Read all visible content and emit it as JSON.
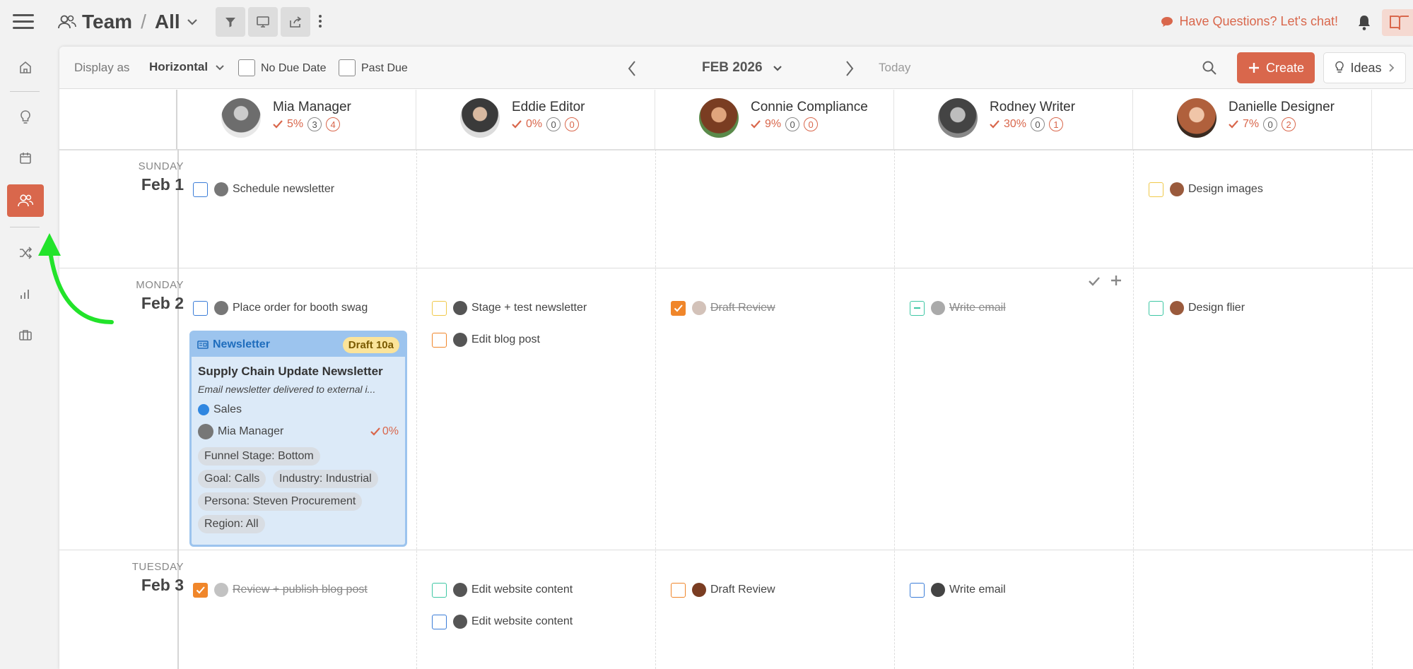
{
  "header": {
    "crumb_section": "Team",
    "crumb_sep": "/",
    "crumb_view": "All",
    "chat": "Have Questions? Let's chat!"
  },
  "toolbar": {
    "display_as_label": "Display as",
    "display_mode": "Horizontal",
    "no_due_date": "No Due Date",
    "past_due": "Past Due",
    "month": "FEB 2026",
    "today": "Today",
    "create": "Create",
    "ideas": "Ideas"
  },
  "people": [
    {
      "name": "Mia Manager",
      "pct": "5%",
      "a": "3",
      "b": "4",
      "avatar_color": "#6d6d6d"
    },
    {
      "name": "Eddie Editor",
      "pct": "0%",
      "a": "0",
      "b": "0",
      "avatar_color": "#7a7a7a"
    },
    {
      "name": "Connie Compliance",
      "pct": "9%",
      "a": "0",
      "b": "0",
      "avatar_color": "#9b5c3c"
    },
    {
      "name": "Rodney Writer",
      "pct": "30%",
      "a": "0",
      "b": "1",
      "avatar_color": "#555555"
    },
    {
      "name": "Danielle Designer",
      "pct": "7%",
      "a": "0",
      "b": "2",
      "avatar_color": "#b0603c"
    }
  ],
  "days": [
    {
      "dow": "SUNDAY",
      "date": "Feb 1"
    },
    {
      "dow": "MONDAY",
      "date": "Feb 2"
    },
    {
      "dow": "TUESDAY",
      "date": "Feb 3"
    }
  ],
  "tasks": {
    "sun_mia": "Schedule newsletter",
    "sun_danielle": "Design images",
    "mon_mia": "Place order for booth swag",
    "mon_eddie_1": "Stage + test newsletter",
    "mon_eddie_2": "Edit blog post",
    "mon_connie": "Draft Review",
    "mon_rodney": "Write email",
    "mon_danielle": "Design flier",
    "tue_mia": "Review + publish blog post",
    "tue_eddie_1": "Edit website content",
    "tue_eddie_2": "Edit website content",
    "tue_connie": "Draft Review",
    "tue_rodney": "Write email"
  },
  "card": {
    "type": "Newsletter",
    "badge": "Draft 10a",
    "title": "Supply Chain Update Newsletter",
    "desc": "Email newsletter delivered to external i...",
    "category": "Sales",
    "owner": "Mia Manager",
    "progress": "0%",
    "tags": [
      "Funnel Stage: Bottom",
      "Goal: Calls",
      "Industry: Industrial",
      "Persona: Steven Procurement",
      "Region: All"
    ]
  },
  "colors": {
    "accent": "#d9674c",
    "blue_box": "#3b7dd8",
    "yellow_box": "#f0c94a",
    "orange_box": "#f0862a",
    "teal_box": "#3ec7a4",
    "arrow": "#22e32a"
  }
}
